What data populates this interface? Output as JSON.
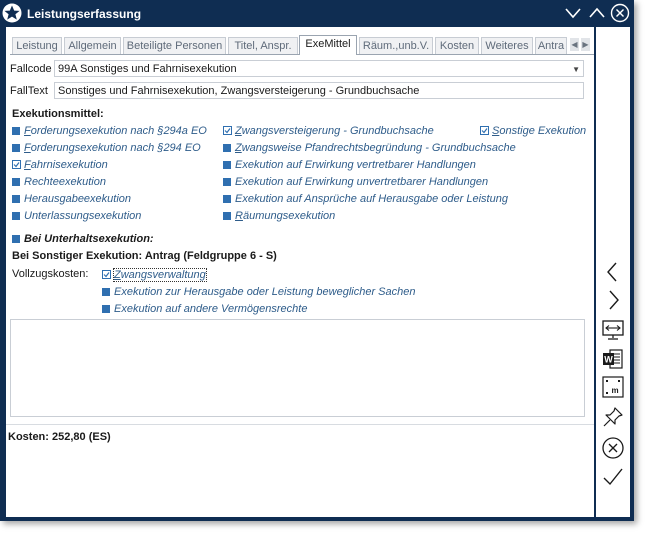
{
  "window": {
    "title": "Leistungserfassung"
  },
  "tabs": [
    {
      "label": "Leistung"
    },
    {
      "label": "Allgemein"
    },
    {
      "label": "Beteiligte Personen"
    },
    {
      "label": "Titel, Anspr."
    },
    {
      "label": "ExeMittel"
    },
    {
      "label": "Räum.,unb.V."
    },
    {
      "label": "Kosten"
    },
    {
      "label": "Weiteres"
    },
    {
      "label": "Antra"
    }
  ],
  "active_tab": "ExeMittel",
  "fields": {
    "fallcode_label": "Fallcode",
    "fallcode_value": "99A Sonstiges und Fahrnisexekution",
    "falltext_label": "FallText",
    "falltext_value": "Sonstiges und Fahrnisexekution, Zwangsversteigerung - Grundbuchsache"
  },
  "exekutionsmittel": {
    "heading": "Exekutionsmittel:",
    "col1": [
      {
        "label": "Forderungsexekution nach §294a EO",
        "checked": false
      },
      {
        "label": "Forderungsexekution nach §294 EO",
        "checked": false
      },
      {
        "label": "Fahrnisexekution",
        "checked": true
      },
      {
        "label": "Rechteexekution",
        "checked": false
      },
      {
        "label": "Herausgabeexekution",
        "checked": false
      },
      {
        "label": "Unterlassungsexekution",
        "checked": false
      }
    ],
    "col2": [
      {
        "label": "Zwangsversteigerung - Grundbuchsache",
        "checked": true
      },
      {
        "label": "Zwangsweise Pfandrechtsbegründung - Grundbuchsache",
        "checked": false
      },
      {
        "label": "Exekution auf Erwirkung vertretbarer Handlungen",
        "checked": false
      },
      {
        "label": "Exekution auf Erwirkung unvertretbarer Handlungen",
        "checked": false
      },
      {
        "label": "Exekution auf Ansprüche auf Herausgabe oder Leistung",
        "checked": false
      },
      {
        "label": "Räumungsexekution",
        "checked": false
      }
    ],
    "col3": [
      {
        "label": "Sonstige Exekution",
        "checked": true
      }
    ]
  },
  "unterhalt": {
    "label": "Bei Unterhaltsexekution:",
    "checked": false
  },
  "sonstiger_heading": "Bei Sonstiger Exekution: Antrag (Feldgruppe 6 - S)",
  "vollzug": {
    "label": "Vollzugskosten:",
    "options": [
      {
        "label": "Zwangsverwaltung",
        "checked": true
      },
      {
        "label": "Exekution zur Herausgabe oder Leistung beweglicher Sachen",
        "checked": false
      },
      {
        "label": "Exekution auf andere Vermögensrechte",
        "checked": false
      }
    ]
  },
  "footer": {
    "kosten": "Kosten: 252,80 (ES)"
  },
  "colors": {
    "titlebar": "#0f2d52",
    "accent": "#2f6fb0",
    "option_text": "#2e5c8a"
  },
  "icons": {
    "logo": "star-logo-icon",
    "minimize": "chevron-down-icon",
    "maximize": "chevron-up-icon",
    "close": "close-circle-icon",
    "right": [
      "chevron-left-icon",
      "chevron-right-icon",
      "monitor-arrows-icon",
      "word-document-icon",
      "mail-merge-icon",
      "pin-icon",
      "cancel-circle-icon",
      "checkmark-icon"
    ]
  }
}
